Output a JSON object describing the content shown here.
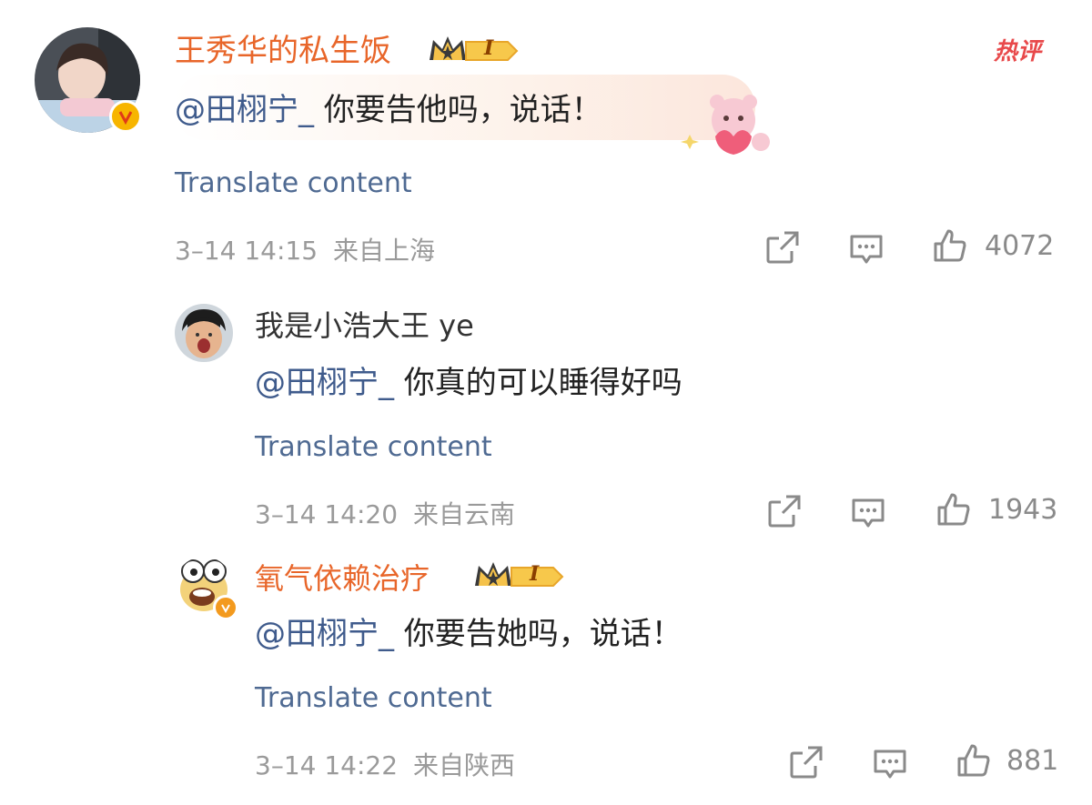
{
  "hot_tag": "热评",
  "comments": [
    {
      "author": "王秀华的私生饭",
      "vip_level": "I",
      "mention": "@田栩宁_",
      "text": " 你要告他吗，说话！",
      "translate": "Translate content",
      "timestamp": "3–14 14:15",
      "location": "来自上海",
      "likes": "4072"
    },
    {
      "author": "我是小浩大王 ye",
      "mention": "@田栩宁_",
      "text": " 你真的可以睡得好吗",
      "translate": "Translate content",
      "timestamp": "3–14 14:20",
      "location": "来自云南",
      "likes": "1943"
    },
    {
      "author": "氧气依赖治疗",
      "vip_level": "I",
      "mention": "@田栩宁_",
      "text": " 你要告她吗，说话！",
      "translate": "Translate content",
      "timestamp": "3–14 14:22",
      "location": "来自陕西",
      "likes": "881"
    }
  ],
  "icons": {
    "share": "share-icon",
    "comment": "comment-icon",
    "like": "like-icon"
  },
  "colors": {
    "username_vip": "#e8662a",
    "mention": "#3f5b8c",
    "translate": "#4f6a92",
    "hot": "#e8494b",
    "verified_badge": "#f7b500"
  }
}
